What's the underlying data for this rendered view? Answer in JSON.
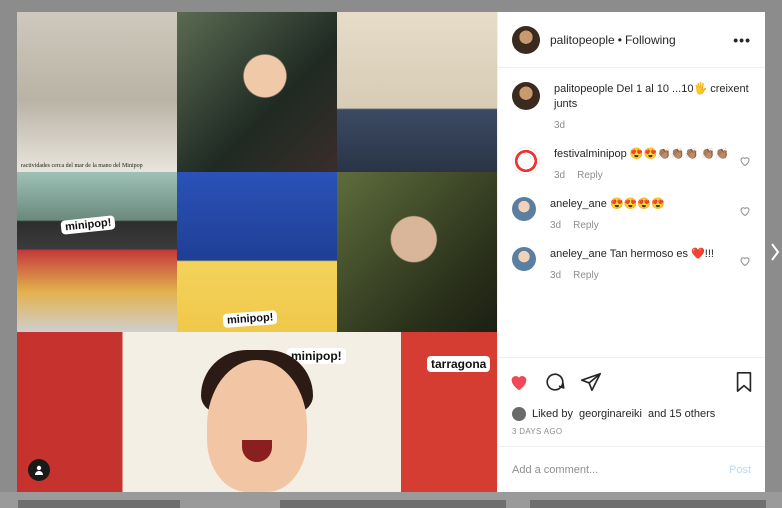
{
  "header": {
    "username": "palitopeople",
    "separator": "•",
    "follow_status": "Following",
    "more_label": "•••"
  },
  "media": {
    "newspaper_caption": "ractividades cerca del mar de la mano del Minipop",
    "logo_text": "minipop!",
    "banner_text_left": "minipop!",
    "banner_text_right": "minipop!",
    "poster_text": "tarragona"
  },
  "comments": [
    {
      "user": "palitopeople",
      "text": "Del 1 al 10 ...10🖐 creixent junts",
      "time": "3d",
      "reply": ""
    },
    {
      "user": "festivalminipop",
      "text": "😍😍👏🏽👏🏽👏🏽 👏🏽👏🏽",
      "time": "3d",
      "reply": "Reply"
    },
    {
      "user": "aneley_ane",
      "text": "😍😍😍😍",
      "time": "3d",
      "reply": "Reply"
    },
    {
      "user": "aneley_ane",
      "text": "Tan hermoso es ❤️!!!",
      "time": "3d",
      "reply": "Reply"
    }
  ],
  "likes": {
    "prefix": "Liked by",
    "user": "georginareiki",
    "suffix": "and 15 others"
  },
  "date": "3 DAYS AGO",
  "add_comment": {
    "placeholder": "Add a comment...",
    "post_label": "Post"
  },
  "colors": {
    "like_red": "#ed4956",
    "post_blue": "#b3dbff",
    "muted": "#8e8e8e"
  }
}
